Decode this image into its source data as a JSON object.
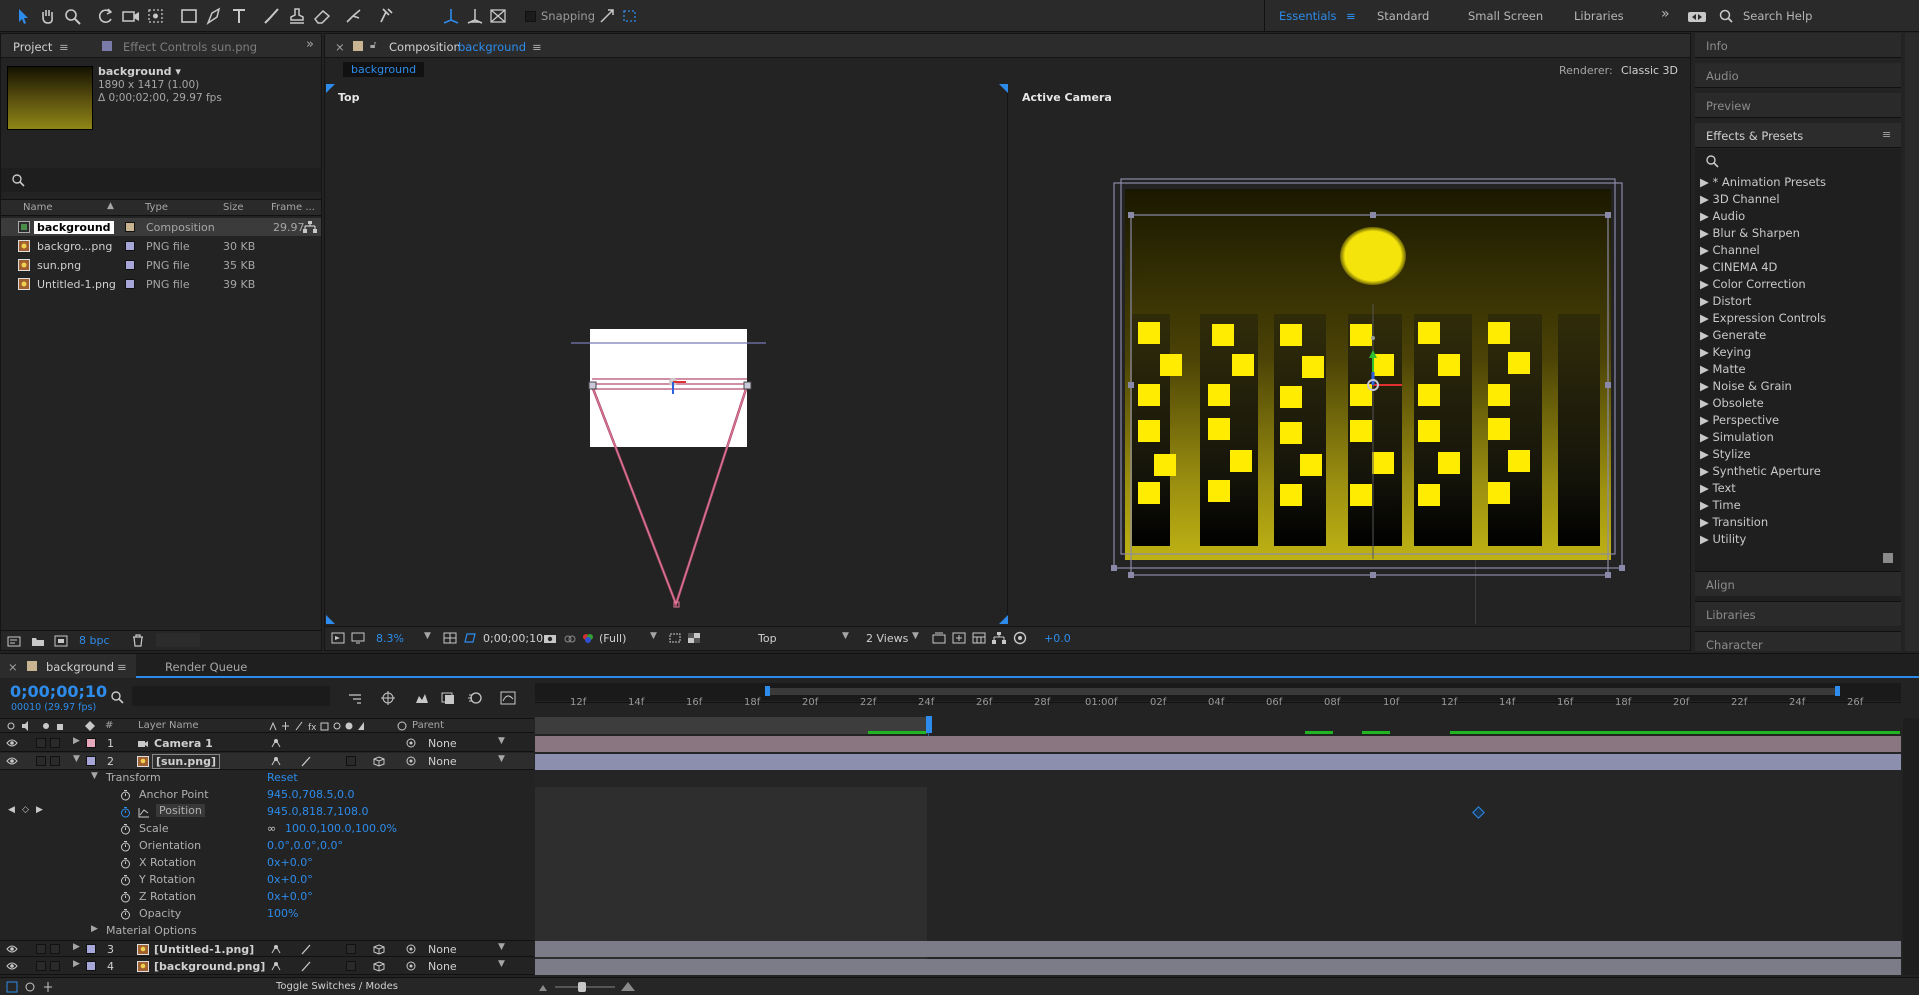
{
  "toolbar": {
    "snapping": "Snapping",
    "workspaces": [
      "Essentials",
      "Standard",
      "Small Screen",
      "Libraries"
    ],
    "search_help": "Search Help"
  },
  "project": {
    "tab_label": "Project",
    "effect_controls_tab": "Effect Controls sun.png",
    "item_name": "background ▾",
    "item_dims": "1890 x 1417 (1.00)",
    "item_dur": "Δ 0;00;02;00, 29.97 fps",
    "columns": {
      "name": "Name",
      "type": "Type",
      "size": "Size",
      "frame": "Frame ..."
    },
    "items": [
      {
        "name": "background",
        "type": "Composition",
        "size": "",
        "frame": "29.97"
      },
      {
        "name": "backgro...png",
        "type": "PNG file",
        "size": "30 KB",
        "frame": ""
      },
      {
        "name": "sun.png",
        "type": "PNG file",
        "size": "35 KB",
        "frame": ""
      },
      {
        "name": "Untitled-1.png",
        "type": "PNG file",
        "size": "39 KB",
        "frame": ""
      }
    ],
    "bpc": "8 bpc"
  },
  "composition": {
    "tab_prefix": "Composition",
    "tab_name": "background",
    "sub_tab": "background",
    "renderer_label": "Renderer:",
    "renderer_value": "Classic 3D",
    "view_left": "Top",
    "view_right": "Active Camera",
    "zoom": "8.3%",
    "timecode": "0;00;00;10",
    "resolution": "(Full)",
    "view_select": "Top",
    "views_count": "2 Views",
    "exposure": "+0.0"
  },
  "right_panels": {
    "info": "Info",
    "audio": "Audio",
    "preview": "Preview",
    "effects_title": "Effects & Presets",
    "effects": [
      "▶ * Animation Presets",
      "▶ 3D Channel",
      "▶ Audio",
      "▶ Blur & Sharpen",
      "▶ Channel",
      "▶ CINEMA 4D",
      "▶ Color Correction",
      "▶ Distort",
      "▶ Expression Controls",
      "▶ Generate",
      "▶ Keying",
      "▶ Matte",
      "▶ Noise & Grain",
      "▶ Obsolete",
      "▶ Perspective",
      "▶ Simulation",
      "▶ Stylize",
      "▶ Synthetic Aperture",
      "▶ Text",
      "▶ Time",
      "▶ Transition",
      "▶ Utility"
    ],
    "align": "Align",
    "libraries": "Libraries",
    "character": "Character"
  },
  "timeline": {
    "tab_label": "background",
    "render_queue": "Render Queue",
    "timecode": "0;00;00;10",
    "timecode_sub": "00010 (29.97 fps)",
    "col_num": "#",
    "col_layer": "Layer Name",
    "col_parent": "Parent",
    "ruler": [
      "12f",
      "14f",
      "16f",
      "18f",
      "20f",
      "22f",
      "24f",
      "26f",
      "28f",
      "01:00f",
      "02f",
      "04f",
      "06f",
      "08f",
      "10f",
      "12f",
      "14f",
      "16f",
      "18f",
      "20f",
      "22f",
      "24f",
      "26f"
    ],
    "layers": [
      {
        "num": "1",
        "name": "Camera 1",
        "parent": "None"
      },
      {
        "num": "2",
        "name": "[sun.png]",
        "parent": "None"
      },
      {
        "num": "3",
        "name": "[Untitled-1.png]",
        "parent": "None"
      },
      {
        "num": "4",
        "name": "[background.png]",
        "parent": "None"
      }
    ],
    "transform": "Transform",
    "reset": "Reset",
    "props": [
      {
        "name": "Anchor Point",
        "value": "945.0,708.5,0.0"
      },
      {
        "name": "Position",
        "value": "945.0,818.7,108.0"
      },
      {
        "name": "Scale",
        "value": "100.0,100.0,100.0%"
      },
      {
        "name": "Orientation",
        "value": "0.0°,0.0°,0.0°"
      },
      {
        "name": "X Rotation",
        "value": "0x+0.0°"
      },
      {
        "name": "Y Rotation",
        "value": "0x+0.0°"
      },
      {
        "name": "Z Rotation",
        "value": "0x+0.0°"
      },
      {
        "name": "Opacity",
        "value": "100%"
      }
    ],
    "material_options": "Material Options",
    "toggle_switches": "Toggle Switches / Modes"
  },
  "colors": {
    "accent": "#2d8ceb",
    "sun": "#f5e40c",
    "window": "#ffec00",
    "camera_bar": "#8a7680",
    "sun_bar": "#8d8fae",
    "layer_bar": "#7c7c88"
  }
}
